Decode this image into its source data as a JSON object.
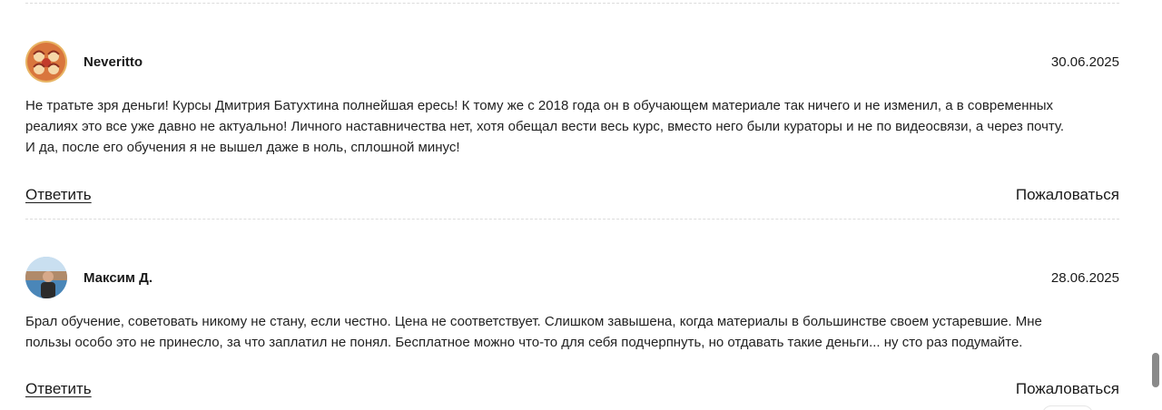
{
  "reviews": [
    {
      "author": "Neveritto",
      "date": "30.06.2025",
      "lines": [
        "Не тратьте зря деньги! Курсы Дмитрия Батухтина полнейшая ересь! К тому же с 2018 года он в обучающем материале так ничего и не изменил, а в современных",
        "реалиях это все уже давно не актуально! Личного наставничества нет, хотя обещал вести весь курс, вместо него были кураторы и не по видеосвязи, а через почту.",
        "И да, после его обучения я не вышел даже в ноль, сплошной минус!"
      ],
      "reply_label": "Ответить",
      "complain_label": "Пожаловаться",
      "avatar_icon": "illustrated-avatar-icon"
    },
    {
      "author": "Максим Д.",
      "date": "28.06.2025",
      "lines": [
        "Брал обучение, советовать никому не стану, если честно. Цена не соответствует. Слишком завышена, когда материалы в большинстве своем устаревшие. Мне",
        "пользы особо это не принесло, за что заплатил не понял. Бесплатное можно что-то для себя подчерпнуть, но отдавать такие деньги... ну сто раз подумайте."
      ],
      "reply_label": "Ответить",
      "complain_label": "Пожаловаться",
      "avatar_icon": "photo-avatar-icon"
    }
  ],
  "colors": {
    "text": "#1a1a1a",
    "divider": "#dcdcdc",
    "scroll_thumb": "#8a8a8a"
  }
}
